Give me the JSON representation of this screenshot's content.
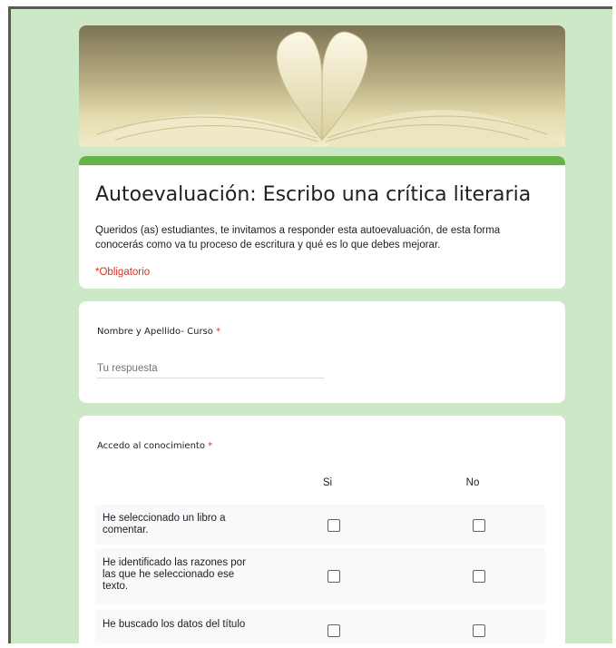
{
  "form": {
    "title": "Autoevaluación: Escribo una crítica literaria",
    "description": "Queridos (as) estudiantes, te invitamos a responder esta autoevaluación, de esta forma conocerás como va tu proceso de escritura y qué es lo que debes mejorar.",
    "required_note": "*Obligatorio",
    "accent_color": "#66b347",
    "background_color": "#cce8c6"
  },
  "question1": {
    "label": "Nombre y Apellido- Curso",
    "required_mark": "*",
    "placeholder": "Tu respuesta"
  },
  "question2": {
    "label": "Accedo al conocimiento",
    "required_mark": "*",
    "columns": [
      "Si",
      "No"
    ],
    "rows": [
      "He seleccionado un libro a comentar.",
      "He identificado las razones por las que he seleccionado ese texto.",
      "He buscado los datos del título"
    ]
  }
}
